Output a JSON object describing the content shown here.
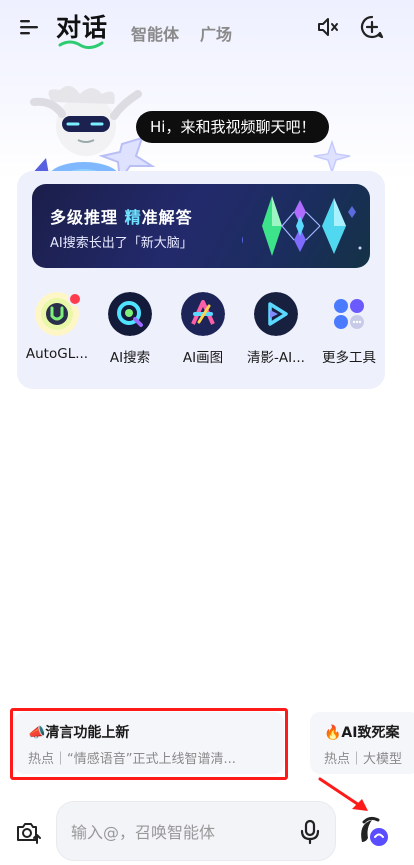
{
  "header": {
    "tab_active": "对话",
    "tab_agent": "智能体",
    "tab_square": "广场"
  },
  "mascot": {
    "greeting": "Hi，来和我视频聊天吧！"
  },
  "banner": {
    "title_part1": "多级推理",
    "title_highlight": "精",
    "title_part2": "准解答",
    "subtitle": "AI搜索长出了「新大脑」"
  },
  "apps": [
    {
      "label": "AutoGL...",
      "icon": "autoglm-icon",
      "badge": true
    },
    {
      "label": "AI搜索",
      "icon": "ai-search-icon"
    },
    {
      "label": "AI画图",
      "icon": "ai-draw-icon"
    },
    {
      "label": "清影-AI...",
      "icon": "qingying-video-icon"
    },
    {
      "label": "更多工具",
      "icon": "more-tools-icon"
    }
  ],
  "notices": [
    {
      "title": "📣清言功能上新",
      "subtitle": "热点｜“情感语音”正式上线智谱清..."
    },
    {
      "title": "🔥AI致死案",
      "subtitle": "热点｜大模型"
    }
  ],
  "input": {
    "placeholder": "输入@，召唤智能体"
  },
  "colors": {
    "annotation_red": "#ff1a1a",
    "banner_highlight": "#6fe3ff",
    "tab_underline": "#2ecc71"
  }
}
